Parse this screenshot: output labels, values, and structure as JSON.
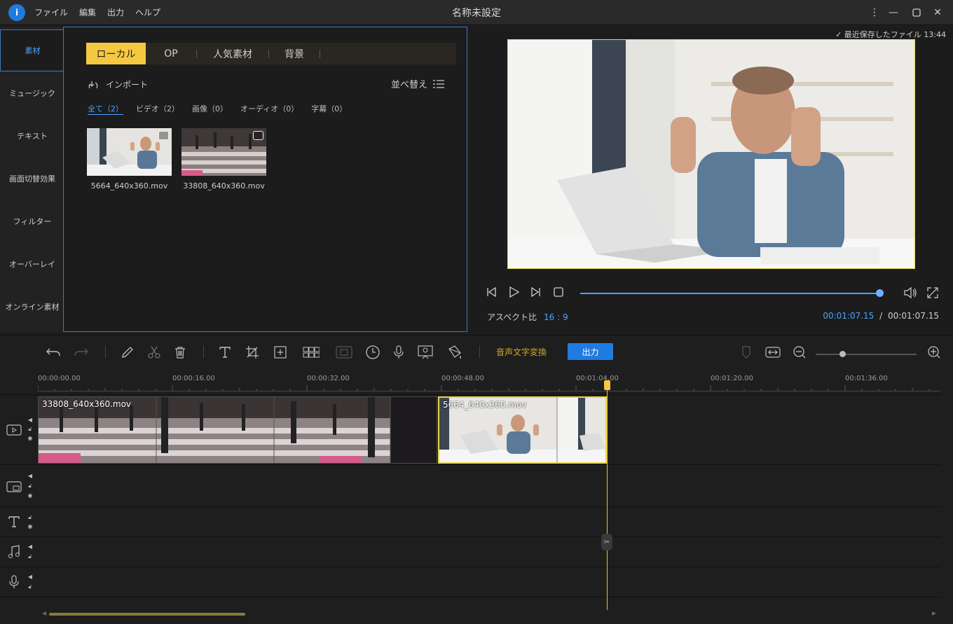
{
  "app": {
    "logo_icon": "app-logo-icon",
    "logo_glyph": "i",
    "title": "名称未設定",
    "menu": [
      "ファイル",
      "編集",
      "出力",
      "ヘルプ"
    ]
  },
  "leftnav": {
    "items": [
      {
        "label": "素材",
        "active": true
      },
      {
        "label": "ミュージック"
      },
      {
        "label": "テキスト"
      },
      {
        "label": "画面切替効果"
      },
      {
        "label": "フィルター"
      },
      {
        "label": "オーバーレイ"
      },
      {
        "label": "オンライン素材"
      }
    ]
  },
  "media": {
    "tabs": [
      "ローカル",
      "OP",
      "人気素材",
      "背景"
    ],
    "import_label": "インポート",
    "sort_label": "並べ替え",
    "filters": [
      "全て（2）",
      "ビデオ（2）",
      "画像（0）",
      "オーディオ（0）",
      "字幕（0）"
    ],
    "files": [
      {
        "name": "5664_640x360.mov"
      },
      {
        "name": "33808_640x360.mov"
      }
    ]
  },
  "preview": {
    "saved_note": "最近保存したファイル 13:44",
    "aspect_label": "アスペクト比",
    "aspect_value": "16 : 9",
    "current_time": "00:01:07.15",
    "separator": "/",
    "total_time": "00:01:07.15",
    "progress": 1.0
  },
  "toolbar": {
    "stt_label": "音声文字変換",
    "export_label": "出力"
  },
  "ruler": {
    "ticks": [
      "00:00:00.00",
      "00:00:16.00",
      "00:00:32.00",
      "00:00:48.00",
      "00:01:04.00",
      "00:01:20.00",
      "00:01:36.00"
    ]
  },
  "timeline": {
    "clips": [
      {
        "name": "33808_640x360.mov"
      },
      {
        "name": "5664_640x360.mov"
      }
    ]
  },
  "colors": {
    "accent": "#1f7be0",
    "highlight": "#f5c842",
    "link": "#4aa3ff"
  }
}
